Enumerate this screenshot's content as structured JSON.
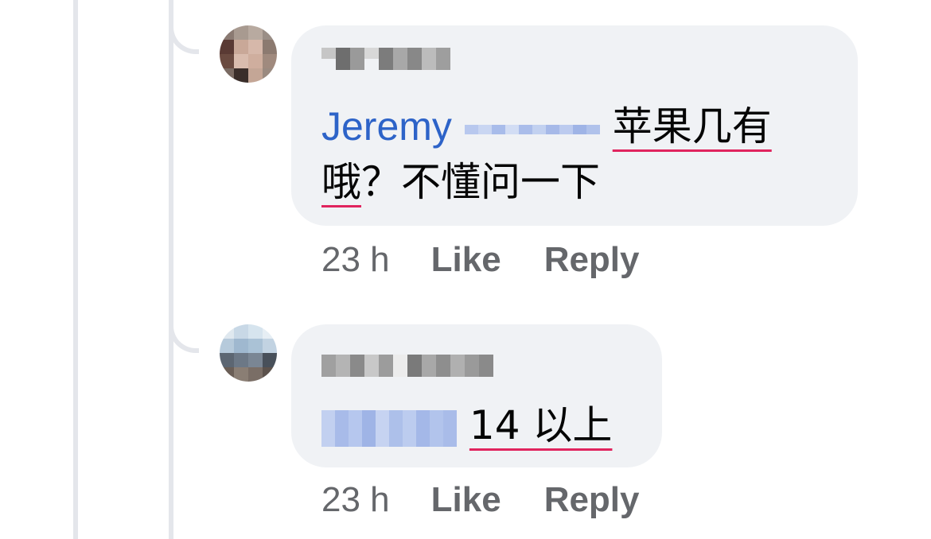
{
  "comments": [
    {
      "mention": "Jeremy",
      "text_line1": "苹果几有",
      "text_line2_a": "哦",
      "text_line2_b": "？不懂问一下",
      "time": "23 h",
      "like_label": "Like",
      "reply_label": "Reply"
    },
    {
      "mention": "",
      "text": "14 以上",
      "time": "23 h",
      "like_label": "Like",
      "reply_label": "Reply"
    }
  ],
  "colors": {
    "bubble": "#f0f2f5",
    "mention": "#2d63c8",
    "meta": "#65676b",
    "spellcheck": "#e0245e",
    "thread_line": "#e4e6eb"
  },
  "icons": {
    "avatar_1": "pixelated-profile-photo",
    "avatar_2": "pixelated-profile-photo"
  }
}
